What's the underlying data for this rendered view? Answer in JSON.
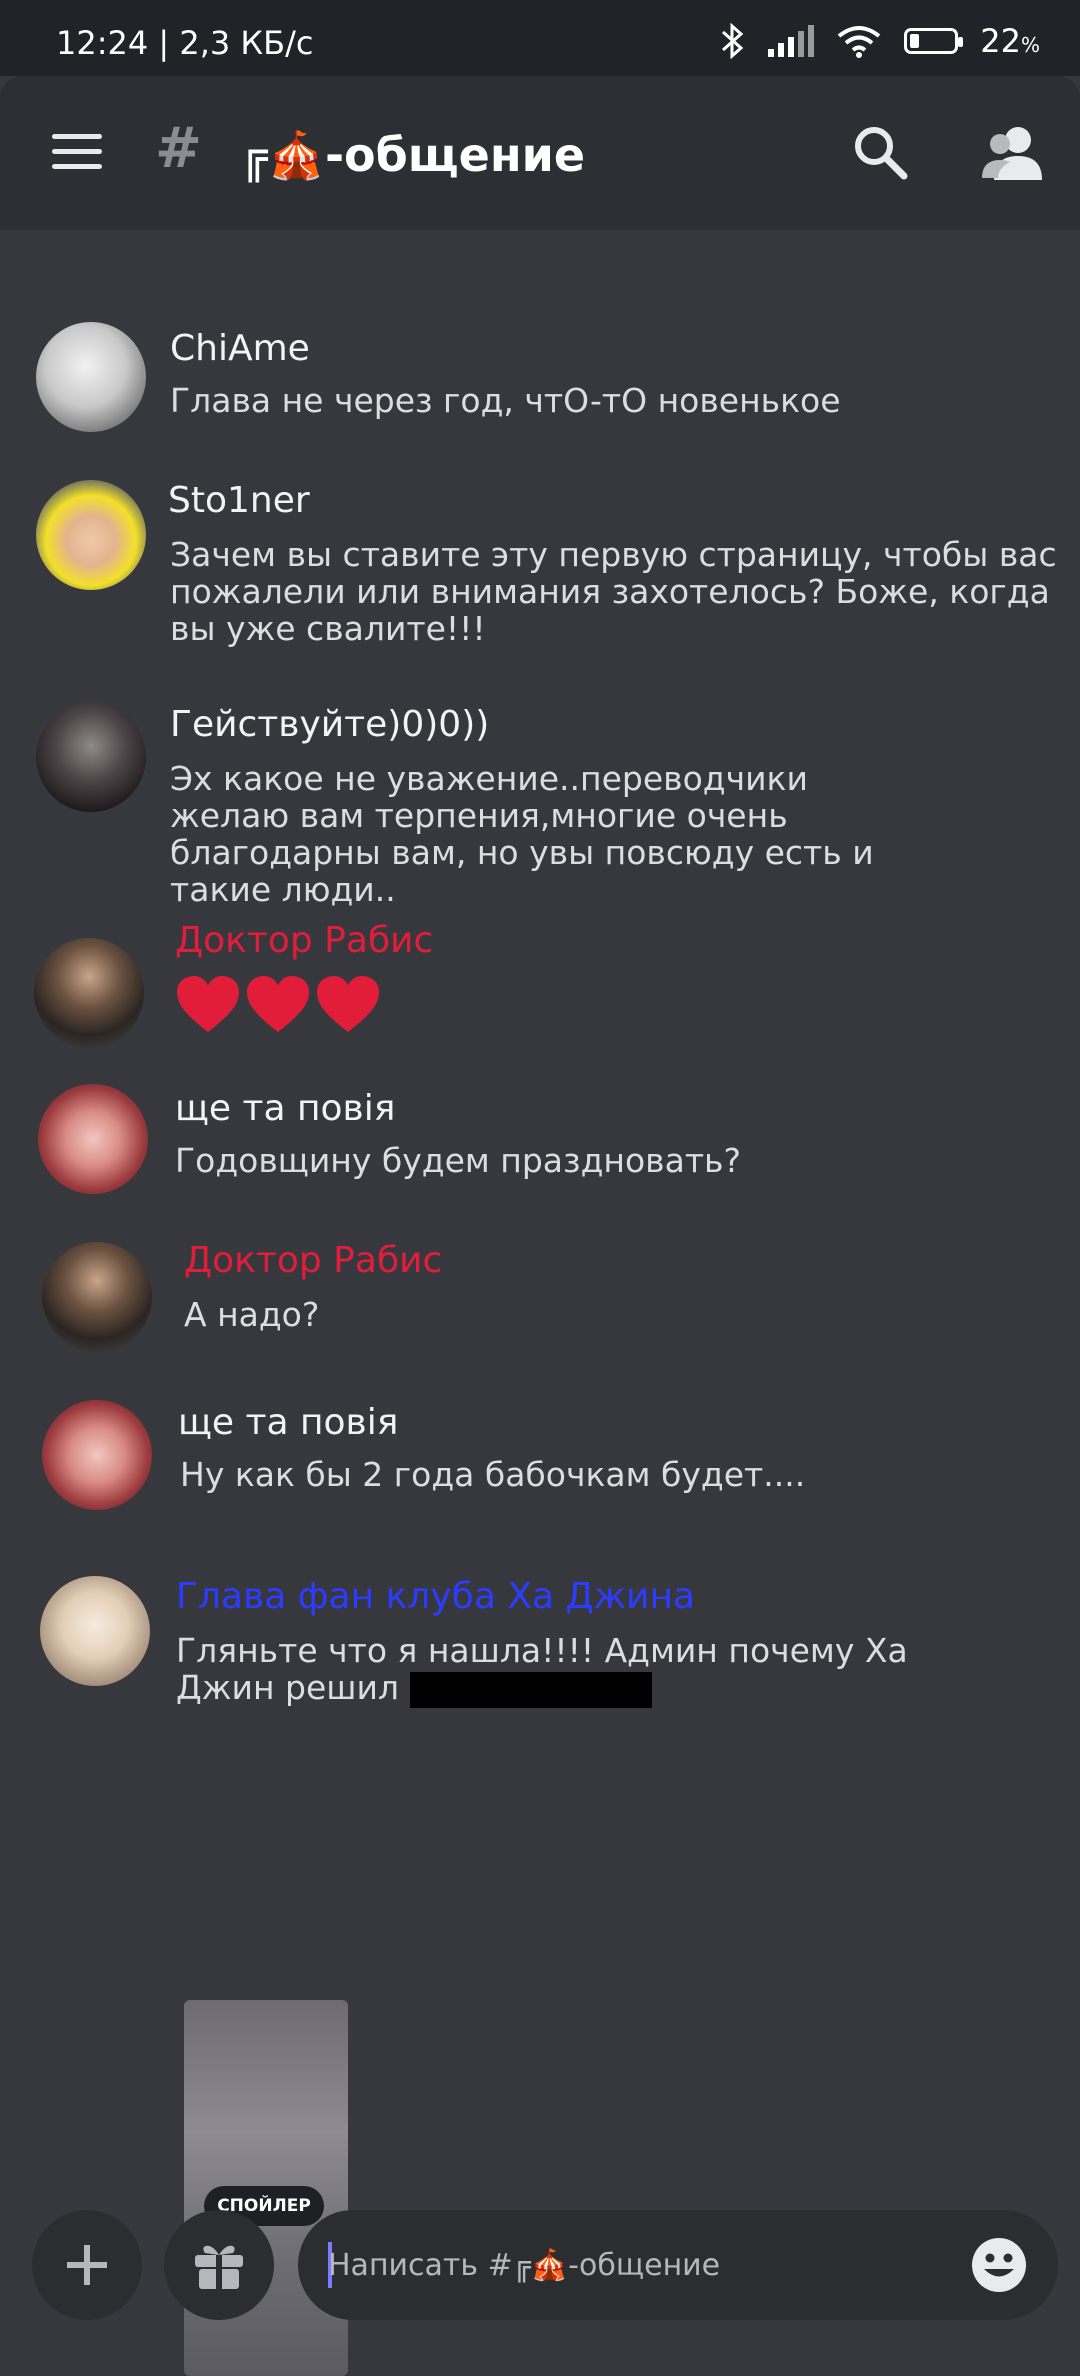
{
  "status_bar": {
    "time": "12:24 | 2,3 КБ/с",
    "battery_percent": "22",
    "battery_suffix": "%",
    "battery_level": 0.22
  },
  "header": {
    "channel_name": "╔🎪-общение"
  },
  "messages": [
    {
      "author": "ChiAme",
      "text": "Глава не через год, чтO-тO новенькое"
    },
    {
      "author": "Sto1ner",
      "text": "Зачем вы ставите эту первую страницу, чтобы вас пожалели или внимания захотелось? Боже, когда вы уже свалите!!!"
    },
    {
      "author": "Гействуйте)0)0))",
      "text": "Эх какое не уважение..переводчики желаю вам терпения,многие очень благодарны вам, но увы повсюду есть и такие люди.."
    },
    {
      "author": "Доктор Рабис",
      "text": ""
    },
    {
      "author": "ще та повія",
      "text": "Годовщину будем праздновать?"
    },
    {
      "author": "Доктор Рабис",
      "text": "А надо?"
    },
    {
      "author": "ще та повія",
      "text": "Ну как бы 2 года бабочкам будет...."
    },
    {
      "author": "Глава фан клуба Ха Джина",
      "text": "Гляньте что я нашла!!!! Админ почему Ха Джин решил"
    }
  ],
  "spoiler_label": "СПОЙЛЕР",
  "composer": {
    "placeholder": "Написать #╔🎪-общение"
  },
  "colors": {
    "background": "#36383e",
    "header": "#2d2f34",
    "red_role": "#e21d3a",
    "blue_role": "#2b3cff"
  }
}
